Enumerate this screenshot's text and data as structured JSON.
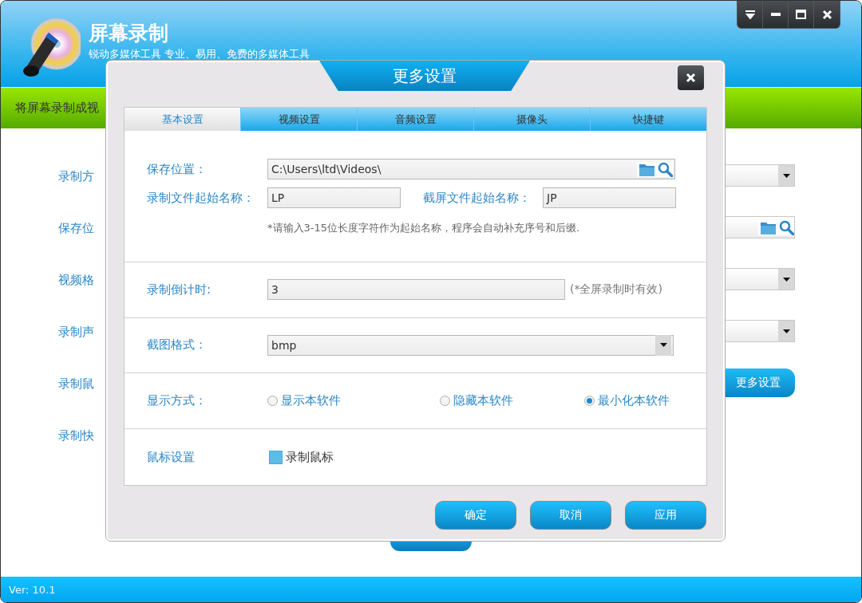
{
  "app": {
    "title": "屏幕录制",
    "subtitle": "锐动多媒体工具 专业、易用、免费的多媒体工具",
    "window_controls": [
      {
        "kind": "menu"
      },
      {
        "kind": "minimize"
      },
      {
        "kind": "maximize"
      },
      {
        "kind": "close"
      }
    ]
  },
  "banner": {
    "text": "将屏幕录制成视"
  },
  "settings": [
    {
      "label": "录制方",
      "kind": "dropdown"
    },
    {
      "label": "保存位",
      "kind": "path"
    },
    {
      "label": "视频格",
      "kind": "dropdown"
    },
    {
      "label": "录制声",
      "kind": "dropdown"
    },
    {
      "label": "录制鼠",
      "kind": "button",
      "button": "更多设置"
    },
    {
      "label": "录制快",
      "kind": "none"
    }
  ],
  "dialog": {
    "title": "更多设置",
    "tabs": [
      {
        "label": "基本设置",
        "selected": true
      },
      {
        "label": "视频设置",
        "selected": false
      },
      {
        "label": "音频设置",
        "selected": false
      },
      {
        "label": "摄像头",
        "selected": false
      },
      {
        "label": "快捷键",
        "selected": false
      }
    ],
    "save_location": {
      "label": "保存位置：",
      "value": "C:\\Users\\ltd\\Videos\\"
    },
    "record_prefix": {
      "label": "录制文件起始名称：",
      "value": "LP"
    },
    "capture_prefix": {
      "label": "截屏文件起始名称：",
      "value": "JP"
    },
    "hint": "*请输入3-15位长度字符作为起始名称，程序会自动补充序号和后缀.",
    "countdown": {
      "label": "录制倒计时:",
      "value": "3",
      "note": "(*全屏录制时有效)"
    },
    "capture_format": {
      "label": "截图格式：",
      "value": "bmp"
    },
    "display_mode": {
      "label": "显示方式：",
      "options": [
        {
          "label": "显示本软件",
          "selected": false
        },
        {
          "label": "隐藏本软件",
          "selected": false
        },
        {
          "label": "最小化本软件",
          "selected": true
        }
      ]
    },
    "mouse": {
      "label": "鼠标设置",
      "checkbox": {
        "label": "录制鼠标",
        "checked": true
      }
    },
    "buttons": [
      "确定",
      "取消",
      "应用"
    ]
  },
  "status_bar": {
    "version": "Ver: 10.1"
  }
}
